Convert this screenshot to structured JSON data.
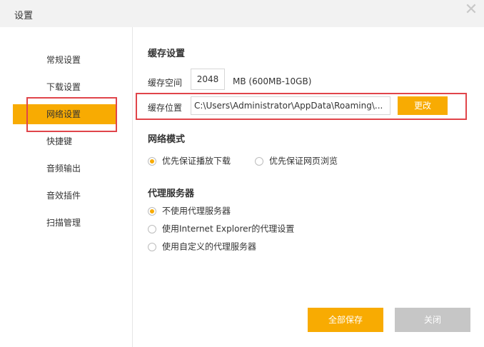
{
  "window": {
    "title": "设置",
    "close_glyph": "✕"
  },
  "sidebar": {
    "items": [
      {
        "label": "常规设置",
        "active": false
      },
      {
        "label": "下载设置",
        "active": false
      },
      {
        "label": "网络设置",
        "active": true
      },
      {
        "label": "快捷键",
        "active": false
      },
      {
        "label": "音频输出",
        "active": false
      },
      {
        "label": "音效插件",
        "active": false
      },
      {
        "label": "扫描管理",
        "active": false
      }
    ]
  },
  "cache": {
    "section_title": "缓存设置",
    "space_label": "缓存空间",
    "space_value": "2048",
    "space_hint": "MB (600MB-10GB)",
    "location_label": "缓存位置",
    "location_value": "C:\\Users\\Administrator\\AppData\\Roaming\\...",
    "change_button": "更改"
  },
  "network_mode": {
    "section_title": "网络模式",
    "options": [
      {
        "label": "优先保证播放下载",
        "selected": true
      },
      {
        "label": "优先保证网页浏览",
        "selected": false
      }
    ]
  },
  "proxy": {
    "section_title": "代理服务器",
    "options": [
      {
        "label": "不使用代理服务器",
        "selected": true
      },
      {
        "label": "使用Internet Explorer的代理设置",
        "selected": false
      },
      {
        "label": "使用自定义的代理服务器",
        "selected": false
      }
    ]
  },
  "footer": {
    "save_all": "全部保存",
    "close": "关闭"
  },
  "colors": {
    "accent": "#f8ab02",
    "highlight_box": "#e0454a",
    "disabled_button": "#c6c6c6"
  }
}
